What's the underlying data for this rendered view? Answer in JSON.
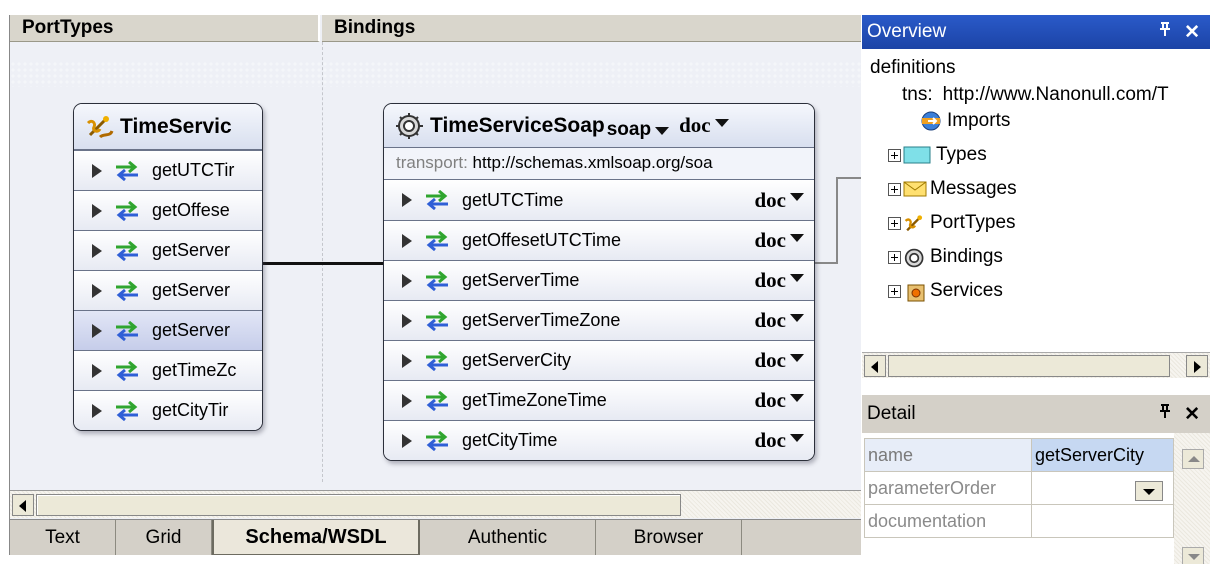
{
  "canvas": {
    "columns": {
      "porttypes": "PortTypes",
      "bindings": "Bindings"
    },
    "porttype_box": {
      "title": "TimeServic",
      "icon": "porttype-icon",
      "operations": [
        "getUTCTir",
        "getOffese",
        "getServer",
        "getServer",
        "getServer",
        "getTimeZc",
        "getCityTir"
      ],
      "selected_index": 4
    },
    "binding_box": {
      "title": "TimeServiceSoap",
      "icon": "binding-icon",
      "protocol": "soap",
      "style": "doc",
      "transport_label": "transport:",
      "transport_value": "http://schemas.xmlsoap.org/soa",
      "operations": [
        {
          "name": "getUTCTime",
          "style": "doc"
        },
        {
          "name": "getOffesetUTCTime",
          "style": "doc"
        },
        {
          "name": "getServerTime",
          "style": "doc"
        },
        {
          "name": "getServerTimeZone",
          "style": "doc"
        },
        {
          "name": "getServerCity",
          "style": "doc"
        },
        {
          "name": "getTimeZoneTime",
          "style": "doc"
        },
        {
          "name": "getCityTime",
          "style": "doc"
        }
      ]
    }
  },
  "tabs": [
    "Text",
    "Grid",
    "Schema/WSDL",
    "Authentic",
    "Browser"
  ],
  "active_tab": "Schema/WSDL",
  "overview": {
    "title": "Overview",
    "pin_glyph": "ᵖ",
    "close_glyph": "✕",
    "root": "definitions",
    "tns_label": "tns:",
    "tns_value": "http://www.Nanonull.com/T",
    "imports": "Imports",
    "nodes": [
      "Types",
      "Messages",
      "PortTypes",
      "Bindings",
      "Services"
    ]
  },
  "detail": {
    "title": "Detail",
    "rows": [
      {
        "key": "name",
        "value": "getServerCity"
      },
      {
        "key": "parameterOrder",
        "value": ""
      },
      {
        "key": "documentation",
        "value": ""
      }
    ]
  },
  "colors": {
    "accent": "#1c44a6",
    "operation_icon_green": "#2fa52f",
    "operation_icon_blue": "#2f5fd6",
    "canvas_bg": "#eef0f6"
  }
}
